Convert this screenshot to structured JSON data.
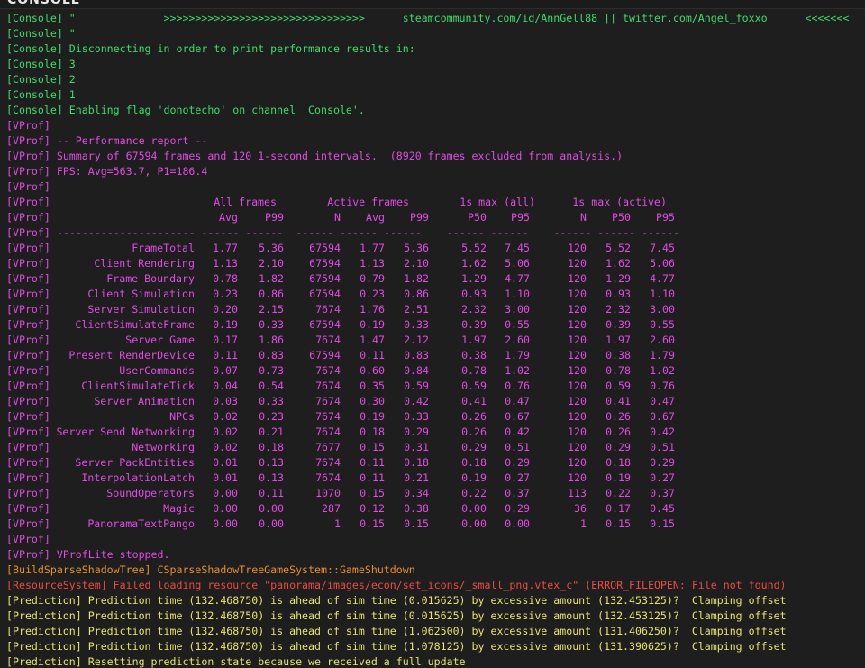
{
  "window": {
    "title": "CONSOLE"
  },
  "colors": {
    "console": "#3ddc6a",
    "vprof": "#e04ce3",
    "build": "#e7902a",
    "resource": "#ec4b43",
    "prediction": "#e6e46b",
    "background": "#1e1e1e"
  },
  "log_top": [
    {
      "cls": "c-console",
      "text": "[Console] \"              >>>>>>>>>>>>>>>>>>>>>>>>>>>>>>>>      steamcommunity.com/id/AnnGell88 || twitter.com/Angel_foxxo      <<<<<<<"
    },
    {
      "cls": "c-console",
      "text": "[Console] \""
    },
    {
      "cls": "c-console",
      "text": "[Console] Disconnecting in order to print performance results in:"
    },
    {
      "cls": "c-console",
      "text": "[Console] 3"
    },
    {
      "cls": "c-console",
      "text": "[Console] 2"
    },
    {
      "cls": "c-console",
      "text": "[Console] 1"
    },
    {
      "cls": "c-console",
      "text": "[Console] Enabling flag 'donotecho' on channel 'Console'."
    },
    {
      "cls": "c-vprof",
      "text": "[VProf]"
    },
    {
      "cls": "c-vprof",
      "text": "[VProf] -- Performance report --"
    },
    {
      "cls": "c-vprof",
      "text": "[VProf] Summary of 67594 frames and 120 1-second intervals.  (8920 frames excluded from analysis.)"
    },
    {
      "cls": "c-vprof",
      "text": "[VProf] FPS: Avg=563.7, P1=186.4"
    },
    {
      "cls": "c-vprof",
      "text": "[VProf]"
    }
  ],
  "vprof_table": {
    "tag": "[VProf]",
    "group_headers": [
      "All frames",
      "Active frames",
      "1s max (all)",
      "1s max (active)"
    ],
    "col_headers": [
      "Avg",
      "P99",
      "N",
      "Avg",
      "P99",
      "P50",
      "P95",
      "N",
      "P50",
      "P95"
    ],
    "separator": "---------------------- ------ ------  ------ ------ ------    ------ ------    ------ ------ ------",
    "rows": [
      {
        "name": "FrameTotal",
        "v": [
          "1.77",
          "5.36",
          "67594",
          "1.77",
          "5.36",
          "5.52",
          "7.45",
          "120",
          "5.52",
          "7.45"
        ]
      },
      {
        "name": "Client Rendering",
        "v": [
          "1.13",
          "2.10",
          "67594",
          "1.13",
          "2.10",
          "1.62",
          "5.06",
          "120",
          "1.62",
          "5.06"
        ]
      },
      {
        "name": "Frame Boundary",
        "v": [
          "0.78",
          "1.82",
          "67594",
          "0.79",
          "1.82",
          "1.29",
          "4.77",
          "120",
          "1.29",
          "4.77"
        ]
      },
      {
        "name": "Client Simulation",
        "v": [
          "0.23",
          "0.86",
          "67594",
          "0.23",
          "0.86",
          "0.93",
          "1.10",
          "120",
          "0.93",
          "1.10"
        ]
      },
      {
        "name": "Server Simulation",
        "v": [
          "0.20",
          "2.15",
          "7674",
          "1.76",
          "2.51",
          "2.32",
          "3.00",
          "120",
          "2.32",
          "3.00"
        ]
      },
      {
        "name": "ClientSimulateFrame",
        "v": [
          "0.19",
          "0.33",
          "67594",
          "0.19",
          "0.33",
          "0.39",
          "0.55",
          "120",
          "0.39",
          "0.55"
        ]
      },
      {
        "name": "Server Game",
        "v": [
          "0.17",
          "1.86",
          "7674",
          "1.47",
          "2.12",
          "1.97",
          "2.60",
          "120",
          "1.97",
          "2.60"
        ]
      },
      {
        "name": "Present_RenderDevice",
        "v": [
          "0.11",
          "0.83",
          "67594",
          "0.11",
          "0.83",
          "0.38",
          "1.79",
          "120",
          "0.38",
          "1.79"
        ]
      },
      {
        "name": "UserCommands",
        "v": [
          "0.07",
          "0.73",
          "7674",
          "0.60",
          "0.84",
          "0.78",
          "1.02",
          "120",
          "0.78",
          "1.02"
        ]
      },
      {
        "name": "ClientSimulateTick",
        "v": [
          "0.04",
          "0.54",
          "7674",
          "0.35",
          "0.59",
          "0.59",
          "0.76",
          "120",
          "0.59",
          "0.76"
        ]
      },
      {
        "name": "Server Animation",
        "v": [
          "0.03",
          "0.33",
          "7674",
          "0.30",
          "0.42",
          "0.41",
          "0.47",
          "120",
          "0.41",
          "0.47"
        ]
      },
      {
        "name": "NPCs",
        "v": [
          "0.02",
          "0.23",
          "7674",
          "0.19",
          "0.33",
          "0.26",
          "0.67",
          "120",
          "0.26",
          "0.67"
        ]
      },
      {
        "name": "Server Send Networking",
        "v": [
          "0.02",
          "0.21",
          "7674",
          "0.18",
          "0.29",
          "0.26",
          "0.42",
          "120",
          "0.26",
          "0.42"
        ]
      },
      {
        "name": "Networking",
        "v": [
          "0.02",
          "0.18",
          "7677",
          "0.15",
          "0.31",
          "0.29",
          "0.51",
          "120",
          "0.29",
          "0.51"
        ]
      },
      {
        "name": "Server PackEntities",
        "v": [
          "0.01",
          "0.13",
          "7674",
          "0.11",
          "0.18",
          "0.18",
          "0.29",
          "120",
          "0.18",
          "0.29"
        ]
      },
      {
        "name": "InterpolationLatch",
        "v": [
          "0.01",
          "0.13",
          "7674",
          "0.11",
          "0.21",
          "0.19",
          "0.27",
          "120",
          "0.19",
          "0.27"
        ]
      },
      {
        "name": "SoundOperators",
        "v": [
          "0.00",
          "0.11",
          "1070",
          "0.15",
          "0.34",
          "0.22",
          "0.37",
          "113",
          "0.22",
          "0.37"
        ]
      },
      {
        "name": "Magic",
        "v": [
          "0.00",
          "0.00",
          "287",
          "0.12",
          "0.38",
          "0.00",
          "0.29",
          "36",
          "0.17",
          "0.45"
        ]
      },
      {
        "name": "PanoramaTextPango",
        "v": [
          "0.00",
          "0.00",
          "1",
          "0.15",
          "0.15",
          "0.00",
          "0.00",
          "1",
          "0.15",
          "0.15"
        ]
      }
    ]
  },
  "log_bottom": [
    {
      "cls": "c-vprof",
      "text": "[VProf]"
    },
    {
      "cls": "c-vprof",
      "text": "[VProf] VProfLite stopped."
    },
    {
      "cls": "c-build",
      "text": "[BuildSparseShadowTree] CSparseShadowTreeGameSystem::GameShutdown"
    },
    {
      "cls": "c-res",
      "text": "[ResourceSystem] Failed loading resource \"panorama/images/econ/set_icons/_small_png.vtex_c\" (ERROR_FILEOPEN: File not found)"
    },
    {
      "cls": "c-pred",
      "text": "[Prediction] Prediction time (132.468750) is ahead of sim time (0.015625) by excessive amount (132.453125)?  Clamping offset"
    },
    {
      "cls": "c-pred",
      "text": "[Prediction] Prediction time (132.468750) is ahead of sim time (0.015625) by excessive amount (132.453125)?  Clamping offset"
    },
    {
      "cls": "c-pred",
      "text": "[Prediction] Prediction time (132.468750) is ahead of sim time (1.062500) by excessive amount (131.406250)?  Clamping offset"
    },
    {
      "cls": "c-pred",
      "text": "[Prediction] Prediction time (132.468750) is ahead of sim time (1.078125) by excessive amount (131.390625)?  Clamping offset"
    },
    {
      "cls": "c-pred",
      "text": "[Prediction] Resetting prediction state because we received a full update"
    }
  ]
}
